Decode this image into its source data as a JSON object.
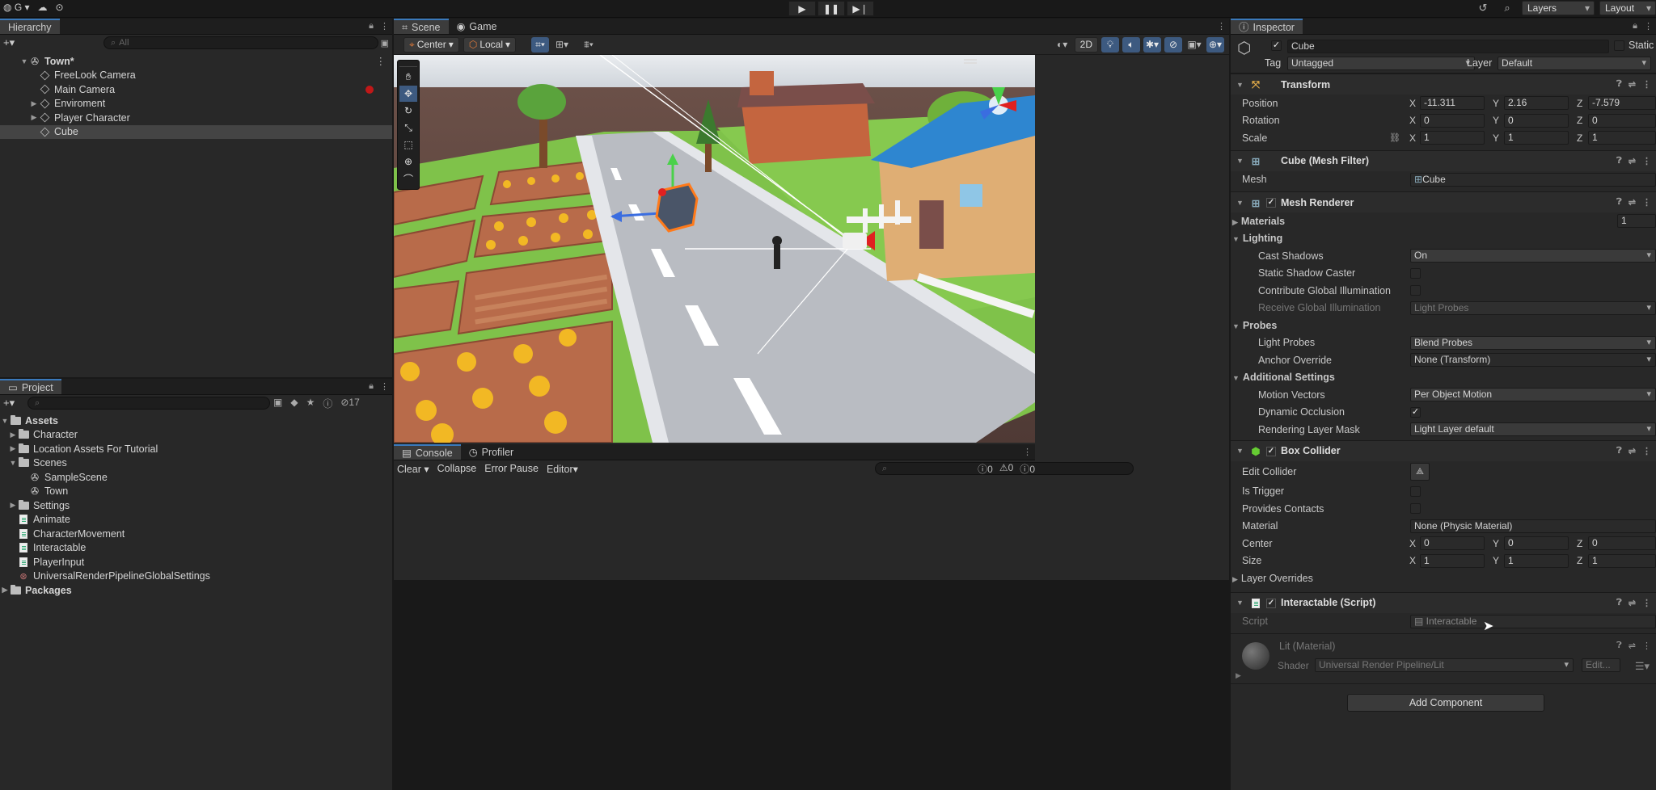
{
  "toolbar": {
    "account_label": "G",
    "layers_label": "Layers",
    "layout_label": "Layout"
  },
  "hierarchy": {
    "tab": "Hierarchy",
    "search_placeholder": "All",
    "scene": "Town*",
    "items": [
      {
        "label": "FreeLook Camera",
        "icon": "cube-icon"
      },
      {
        "label": "Main Camera",
        "icon": "cube-icon"
      },
      {
        "label": "Enviroment",
        "icon": "cube-icon"
      },
      {
        "label": "Player Character",
        "icon": "cube-icon"
      },
      {
        "label": "Cube",
        "icon": "cube-icon"
      }
    ]
  },
  "project": {
    "tab": "Project",
    "count": "17",
    "root": "Assets",
    "items": [
      {
        "label": "Character"
      },
      {
        "label": "Location Assets For Tutorial"
      },
      {
        "label": "Scenes"
      },
      {
        "label": "SampleScene"
      },
      {
        "label": "Town"
      },
      {
        "label": "Settings"
      },
      {
        "label": "Animate"
      },
      {
        "label": "CharacterMovement"
      },
      {
        "label": "Interactable"
      },
      {
        "label": "PlayerInput"
      },
      {
        "label": "UniversalRenderPipelineGlobalSettings"
      }
    ],
    "packages": "Packages"
  },
  "scene_view": {
    "tabs": [
      "Scene",
      "Game"
    ],
    "pivot": "Center",
    "space": "Local",
    "mode_2d": "2D"
  },
  "console": {
    "tabs": [
      "Console",
      "Profiler"
    ],
    "clear": "Clear",
    "collapse": "Collapse",
    "error_pause": "Error Pause",
    "editor": "Editor",
    "counts": [
      "0",
      "0",
      "0"
    ]
  },
  "inspector": {
    "tab": "Inspector",
    "object_name": "Cube",
    "static_label": "Static",
    "tag_label": "Tag",
    "tag_value": "Untagged",
    "layer_label": "Layer",
    "layer_value": "Default",
    "transform": {
      "title": "Transform",
      "position_label": "Position",
      "rotation_label": "Rotation",
      "scale_label": "Scale",
      "axes": [
        "X",
        "Y",
        "Z"
      ],
      "position": [
        "-11.311",
        "2.16",
        "-7.579"
      ],
      "rotation": [
        "0",
        "0",
        "0"
      ],
      "scale": [
        "1",
        "1",
        "1"
      ]
    },
    "mesh_filter": {
      "title": "Cube (Mesh Filter)",
      "mesh_label": "Mesh",
      "mesh_value": "Cube"
    },
    "mesh_renderer": {
      "title": "Mesh Renderer",
      "materials": "Materials",
      "materials_count": "1",
      "lighting": "Lighting",
      "cast_shadows": "Cast Shadows",
      "cast_shadows_value": "On",
      "static_shadow_caster": "Static Shadow Caster",
      "contribute_gi": "Contribute Global Illumination",
      "receive_gi": "Receive Global Illumination",
      "receive_gi_value": "Light Probes",
      "probes": "Probes",
      "light_probes": "Light Probes",
      "light_probes_value": "Blend Probes",
      "anchor_override": "Anchor Override",
      "anchor_override_value": "None (Transform)",
      "additional_settings": "Additional Settings",
      "motion_vectors": "Motion Vectors",
      "motion_vectors_value": "Per Object Motion",
      "dynamic_occlusion": "Dynamic Occlusion",
      "rendering_layer_mask": "Rendering Layer Mask",
      "rendering_layer_mask_value": "Light Layer default"
    },
    "box_collider": {
      "title": "Box Collider",
      "edit_collider": "Edit Collider",
      "is_trigger": "Is Trigger",
      "provides_contacts": "Provides Contacts",
      "material": "Material",
      "material_value": "None (Physic Material)",
      "center": "Center",
      "size": "Size",
      "center_values": [
        "0",
        "0",
        "0"
      ],
      "size_values": [
        "1",
        "1",
        "1"
      ],
      "layer_overrides": "Layer Overrides"
    },
    "interactable": {
      "title": "Interactable (Script)",
      "script_label": "Script",
      "script_value": "Interactable"
    },
    "material": {
      "title": "Lit (Material)",
      "shader_label": "Shader",
      "shader_value": "Universal Render Pipeline/Lit",
      "edit": "Edit..."
    },
    "add_component": "Add Component"
  }
}
